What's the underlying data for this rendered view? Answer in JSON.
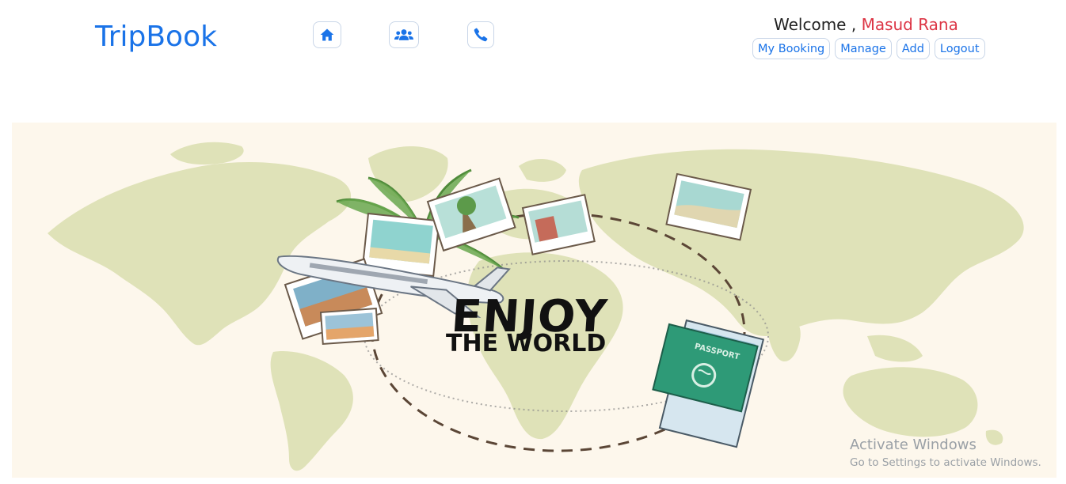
{
  "header": {
    "brand": "TripBook",
    "nav": [
      {
        "icon": "home-icon"
      },
      {
        "icon": "users-icon"
      },
      {
        "icon": "phone-icon"
      }
    ],
    "welcome_prefix": "Welcome ,",
    "user_name": "Masud Rana",
    "actions": {
      "my_booking": "My Booking",
      "manage": "Manage",
      "add": "Add",
      "logout": "Logout"
    }
  },
  "banner": {
    "headline_line1": "ENJOY",
    "headline_line2": "THE WORLD",
    "passport_label": "PASSPORT"
  },
  "watermark": {
    "title": "Activate Windows",
    "subtitle": "Go to Settings to activate Windows."
  },
  "colors": {
    "brand": "#1a73e8",
    "user_name": "#dc3545",
    "banner_bg": "#fdf7ec",
    "map_land": "#dfe2b8"
  }
}
